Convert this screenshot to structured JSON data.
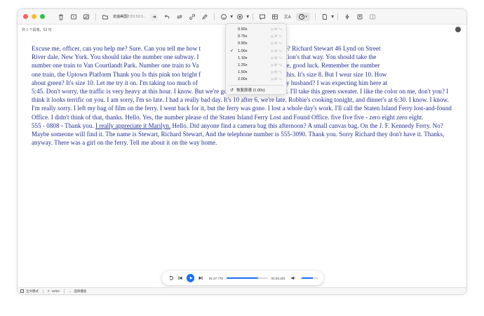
{
  "titlebar": {
    "filename": "走遍美国2",
    "filename_time": "(01:53:3..."
  },
  "subbar": {
    "info": "共 1 个段落，53 句"
  },
  "speed_menu": {
    "items": [
      {
        "label": "0.50x",
        "checked": false
      },
      {
        "label": "0.75x",
        "checked": false
      },
      {
        "label": "0.90x",
        "checked": false
      },
      {
        "label": "1.00x",
        "checked": true
      },
      {
        "label": "1.10x",
        "checked": false
      },
      {
        "label": "1.25x",
        "checked": false
      },
      {
        "label": "1.50x",
        "checked": false
      },
      {
        "label": "2.00x",
        "checked": false
      }
    ],
    "reset_label": "恢复原速 (1.00x)"
  },
  "content": {
    "para1": "Excuse me, officer, can you help me? Sure. Can you tell me how t",
    "para1_b": "et and Riverdale? Richard Stewart 46 Lynd on Street",
    "line2a": "River dale, New York. You should take the number one subway. I",
    "line2b": "here? Yes, the station's that way. You should take the",
    "line3a": "number one train to Van Courtlandt Park. Number one train to Va",
    "line3b": "ank you. Any time, good luck. Remember the number",
    "line4a": "one train, the Uptown Platform Thank you Is this pink too bright f",
    "line4b": "bright pink. Try this. It's size 8. But I wear size 10. How",
    "line5a": "about green? It's size 10. Let me try it on. I'm taking too much of",
    "line5b": "clock. Where's my husband? I was expecting him here at",
    "rest": "5:45. Don't worry, the traffic is very heavy at this hour. I know. But we're going to be late for dinner. I'll take this green sweater. I like the color on me, don't you? I think it looks terrific on you. I am sorry, I'm so late. I had a really bad day. It's 10 after 6, we're late. Robbie's cooking tonight,  and dinner's at 6:30. I know. I know. I'm really sorry. I left my bag of film on the ferry. I went back for it, but the ferry was gone. I lost a whole day's work. I'll call the Staten Island Ferry lost-and-found Office. I didn't think of that, thanks. Hello. Yes, the number please of the Staten Island Ferry Lost and Found Office. five five five - zero eight zero eight.",
    "line_num": "555 - 0808 ◦  Thank you. ",
    "underlined": "I really appreciate it Marilyn.",
    "rest2": " Hello. Did anyone find a camera bag this afternoon? A small canvas bag. On the J. F. Kennedy Ferry. No? Maybe someone will find it. The name is Stewart, Richard Stewart, And the telephone number is 555-3090. Thank you. Sorry Richard they don't have it. Thanks, anyway. There was a girl on the ferry. Tell me about it on the way home."
  },
  "player": {
    "current_time": "01:27.778",
    "total_time": "01:53.331",
    "progress_percent": 77,
    "volume_percent": 70,
    "accent": "#1b6ff5"
  },
  "statusbar": {
    "mode": "全文模式",
    "count": "43/53",
    "selection": "选择播放"
  }
}
